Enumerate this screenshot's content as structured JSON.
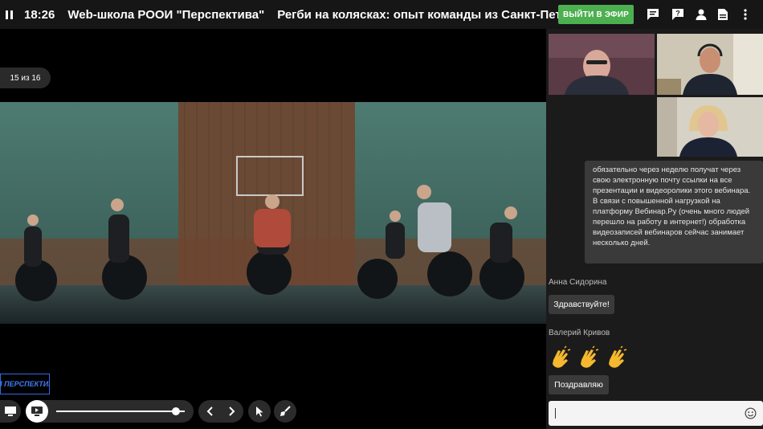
{
  "header": {
    "time": "18:26",
    "school": "Web-школа РООИ \"Перспектива\"",
    "topic": "Регби на колясках: опыт команды из Санкт-Петербурга",
    "onair_button": "ВЫЙТИ В ЭФИР",
    "icons": [
      "pause-icon",
      "chat-icon",
      "help-icon",
      "user-icon",
      "document-icon",
      "more-icon"
    ]
  },
  "presentation": {
    "slide_counter": "15 из 16",
    "logo_text": "ОИ ПЕРСПЕКТИВА",
    "volume_level": 0.93
  },
  "chat": {
    "info_message": "обязательно через неделю получат через свою электронную почту ссылки на все презентации и видеоролики этого вебинара.\nВ связи с повышенной нагрузкой на платформу Вебинар.Ру (очень много людей перешло на работу в интернет!) обработка видеозаписей вебинаров сейчас занимает несколько дней.",
    "messages": [
      {
        "author": "Анна Сидорина",
        "text": "Здравствуйте!"
      },
      {
        "author": "Валерий Кривов",
        "text": "👏👏👏"
      },
      {
        "author": "",
        "text": "Поздравляю"
      }
    ],
    "input_value": ""
  },
  "colors": {
    "accent": "#4caf50",
    "logo_blue": "#2d6cdf"
  }
}
